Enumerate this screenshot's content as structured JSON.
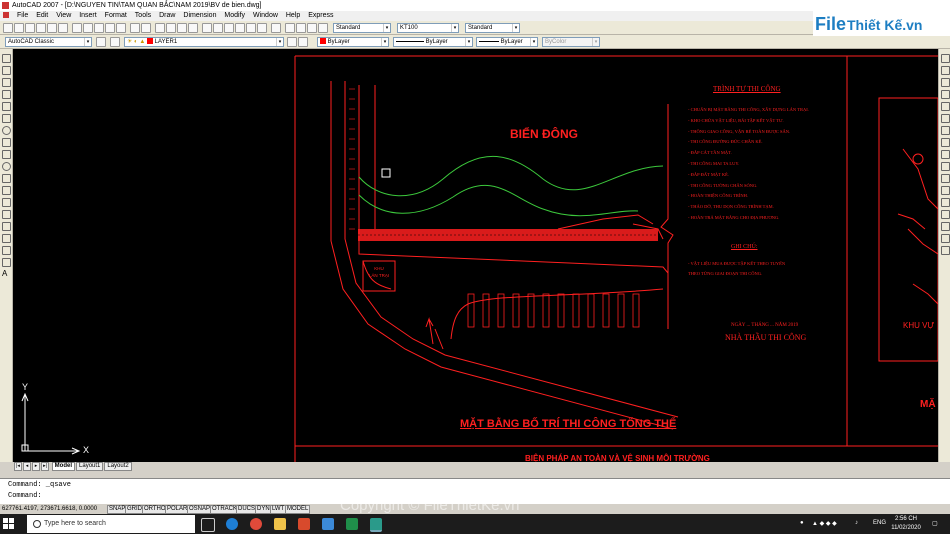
{
  "window": {
    "title": "AutoCAD 2007 - [D:\\NGUYEN TIN\\TAM QUAN BẮC\\NAM 2019\\BV de bien.dwg]"
  },
  "menu": [
    "File",
    "Edit",
    "View",
    "Insert",
    "Format",
    "Tools",
    "Draw",
    "Dimension",
    "Modify",
    "Window",
    "Help",
    "Express"
  ],
  "styles": {
    "text_style": "Standard",
    "dim_style": "KT100",
    "table_style": "Standard"
  },
  "workspace": "AutoCAD Classic",
  "layer": "LAYER1",
  "color": "ByLayer",
  "linetype": "ByLayer",
  "lineweight": "ByLayer",
  "plotstyle": "ByColor",
  "logo": {
    "left": "File",
    "right": "Thiết Kế.vn"
  },
  "drawing": {
    "sea_label": "BIỂN ĐÔNG",
    "title_bottom": "MẶT BẰNG BỐ TRÍ THI CÔNG TỔNG THỂ",
    "title_bottom2": "BIỆN PHÁP AN TOÀN VÀ VỆ SINH MÔI TRƯỜNG",
    "order_title": "TRÌNH TỰ THI CÔNG",
    "order_steps": [
      "- CHUẨN BỊ MẶT BẰNG THI CÔNG, XÂY DỰNG LÁN TRẠI.",
      "- KHO CHỨA VẬT LIỆU, BÃI TẬP KẾT VẬT TƯ.",
      "- THÔNG GIAO CÔNG, VẬN RẺ TOÀN ĐƯỢC SẮN.",
      "- THI CÔNG ĐƯỜNG ĐỨC CHÂN KÈ.",
      "- ĐẮP CÁT TẦN MẶT.",
      "- THI CÔNG MAI TA LUY.",
      "- ĐẮP ĐẤT MẶT KÈ.",
      "- THI CÔNG TƯỜNG CHẮN SÓNG.",
      "- HOÀN THIỆN CÔNG TRÌNH.",
      "- THÁO DỠ, THU DỌN CÔNG TRÌNH TẠM.",
      "- HOÀN TRẢ MẶT BẰNG CHO ĐỊA PHƯƠNG."
    ],
    "notes_title": "GHI CHÚ:",
    "notes": [
      "- VẬT LIỆU MUA ĐƯỢC TẬP KẾT THEO TUYẾN",
      "THEO TỪNG GIAI ĐOẠN THI CÔNG."
    ],
    "date_line": "NGÀY ... THÁNG ... NĂM 2019",
    "contractor": "NHÀ THẦU THI CÔNG",
    "small_box": [
      "KHU",
      "LÁN TRẠI"
    ],
    "right_label": "KHU VỰ",
    "right_label2": "MẶ",
    "ucs_x": "X",
    "ucs_y": "Y"
  },
  "tabs": [
    "Model",
    "Layout1",
    "Layout2"
  ],
  "command_lines": [
    "Command: _qsave",
    "Command:"
  ],
  "status": {
    "coords": "627761.4197, 273671.6618, 0.0000",
    "modes": [
      "SNAP",
      "GRID",
      "ORTHO",
      "POLAR",
      "OSNAP",
      "OTRACK",
      "DUCS",
      "DYN",
      "LWT",
      "MODEL"
    ]
  },
  "taskbar": {
    "search_placeholder": "Type here to search",
    "lang": "ENG",
    "time": "2:56 CH",
    "date": "11/02/2020"
  },
  "watermark": "Copyright © FileThietKe.vn",
  "colors": {
    "cad_red": "#ff2020",
    "cad_green": "#3cc83c",
    "cad_bg": "#000000",
    "toolbar": "#ece9d8"
  }
}
